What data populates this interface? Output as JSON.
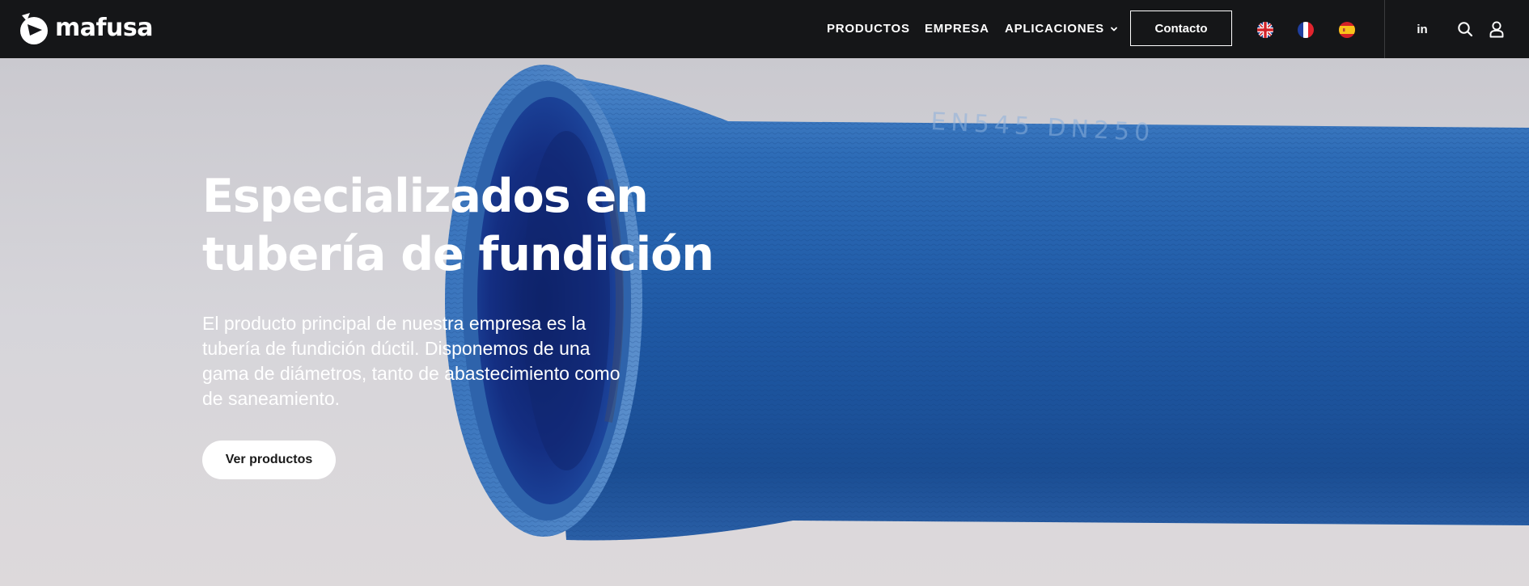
{
  "header": {
    "brand_name": "mafusa",
    "nav": {
      "products": "PRODUCTOS",
      "company": "EMPRESA",
      "applications": "APLICACIONES"
    },
    "contact_label": "Contacto",
    "languages": [
      "en",
      "fr",
      "es"
    ],
    "social_label": "in",
    "icons": [
      "mafusa-logo-icon",
      "chevron-down-icon",
      "uk-flag-icon",
      "france-flag-icon",
      "spain-flag-icon",
      "linkedin-icon",
      "search-icon",
      "user-icon"
    ]
  },
  "hero": {
    "title": "Especializados en tubería de fundición",
    "description": "El producto principal de nuestra empresa es la tubería de fundición dúctil. Disponemos de una gama de diámetros, tanto de abastecimiento como de saneamiento.",
    "button_label": "Ver productos",
    "image": "blue-ductile-iron-pipe-photo",
    "pipe_marking": "EN545 DN250"
  },
  "colors": {
    "header_bg": "#151618",
    "pipe_blue": "#1d5aa8",
    "background": "#d9d8dc",
    "text_light": "#ffffff"
  }
}
